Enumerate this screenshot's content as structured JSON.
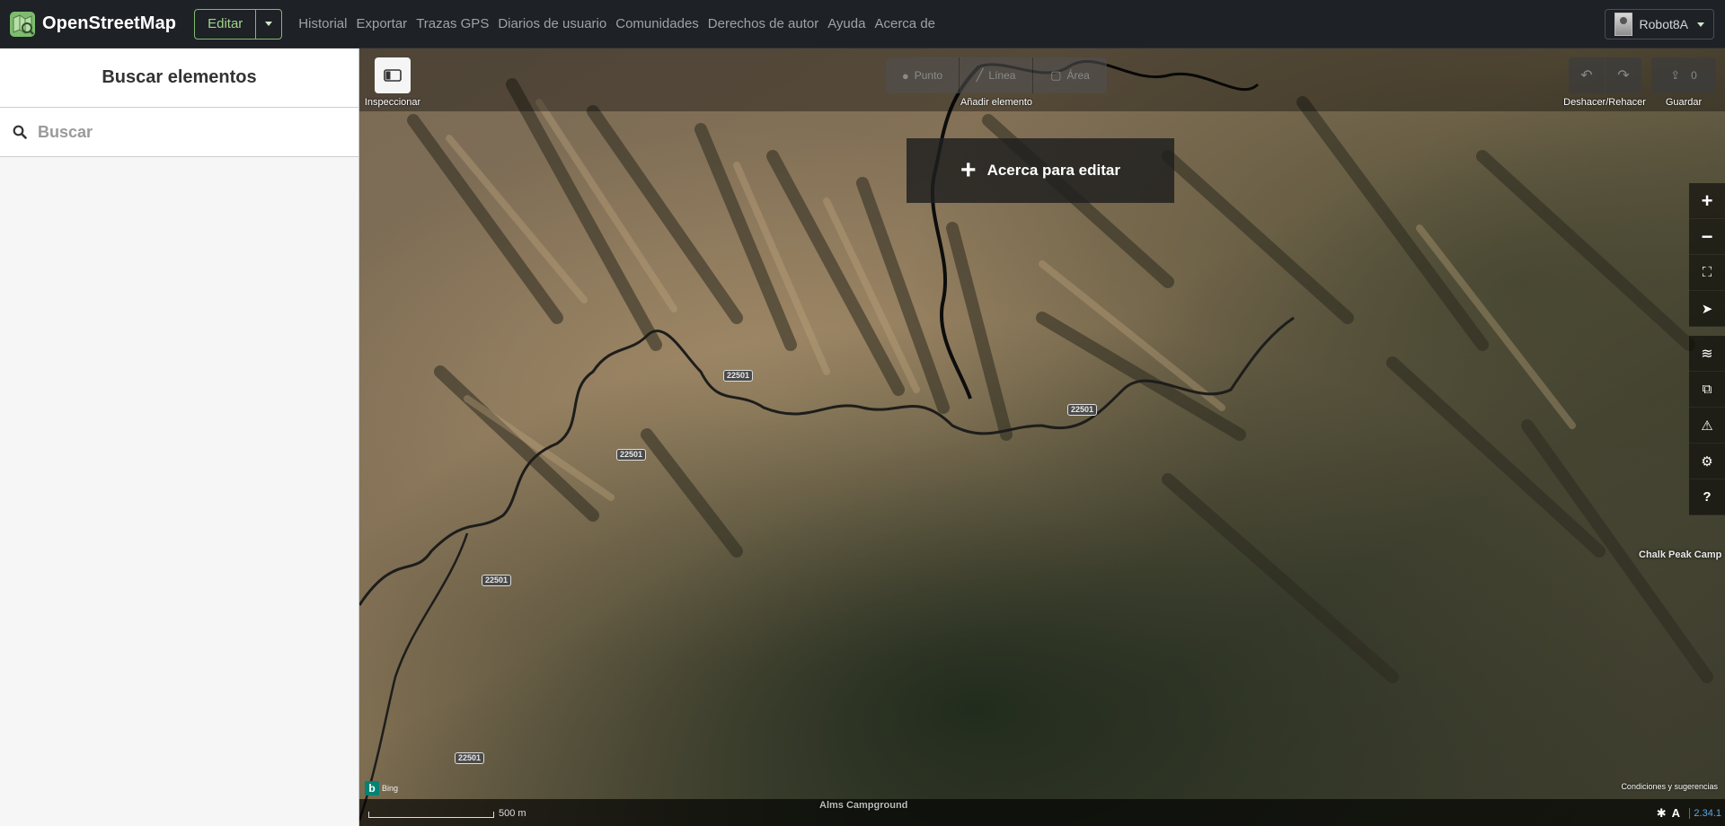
{
  "navbar": {
    "brand": "OpenStreetMap",
    "edit_label": "Editar",
    "links": [
      "Historial",
      "Exportar",
      "Trazas GPS",
      "Diarios de usuario",
      "Comunidades",
      "Derechos de autor",
      "Ayuda",
      "Acerca de"
    ],
    "user_name": "Robot8A"
  },
  "sidebar": {
    "title": "Buscar elementos",
    "search_placeholder": "Buscar"
  },
  "toolbar": {
    "inspect_label": "Inspeccionar",
    "add_feature_label": "Añadir elemento",
    "add_buttons": [
      "Punto",
      "Línea",
      "Área"
    ],
    "undo_redo_label": "Deshacer/Rehacer",
    "save_label": "Guardar",
    "save_count": "0"
  },
  "map": {
    "zoom_notice": "Acerca para editar",
    "road_labels": [
      "22501",
      "22501",
      "22501",
      "22501",
      "22501"
    ],
    "place_labels": {
      "chalk_peak": "Chalk Peak Camp",
      "alms": "Alms Campground"
    },
    "imagery_source": "Bing",
    "terms": "Condiciones y sugerencias",
    "scale": "500 m",
    "version": "2.34.1"
  },
  "colors": {
    "navbar_bg": "#1e2125",
    "accent_green": "#7ebc6f",
    "sidebar_bg": "#f6f6f6",
    "version_link": "#5aa9e6"
  }
}
